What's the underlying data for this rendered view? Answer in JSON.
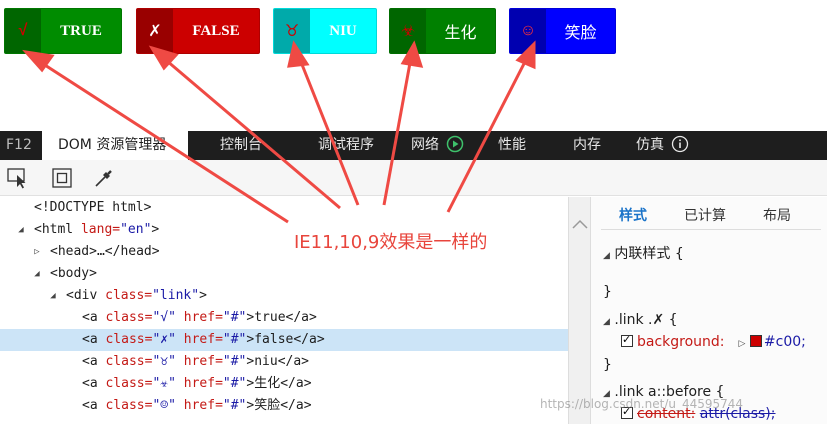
{
  "demo_buttons": [
    {
      "icon": "√",
      "label": "TRUE",
      "icon_color": "#cc0000",
      "bg": "#008c00",
      "icon_bg": "#006600"
    },
    {
      "icon": "✗",
      "label": "FALSE",
      "icon_color": "#ffffff",
      "bg": "#cc0000",
      "icon_bg": "#990000"
    },
    {
      "icon": "♉",
      "label": "NIU",
      "icon_color": "#cc0000",
      "bg": "#00ffff",
      "icon_bg": "#00aaaa"
    },
    {
      "icon": "☣",
      "label": "生化",
      "icon_color": "#cc0000",
      "bg": "#008000",
      "icon_bg": "#006600"
    },
    {
      "icon": "☺",
      "label": "笑脸",
      "icon_color": "#ff3333",
      "bg": "#0000ff",
      "icon_bg": "#0000b0"
    }
  ],
  "devtools": {
    "f12": "F12",
    "tabs": [
      "DOM 资源管理器",
      "控制台",
      "调试程序",
      "网络",
      "性能",
      "内存",
      "仿真"
    ]
  },
  "dom_tree": {
    "doctype": "<!DOCTYPE html>",
    "html_open": "<html ",
    "html_attr": "lang=",
    "html_val": "\"en\"",
    "html_close": ">",
    "head": "<head>…</head>",
    "body": "<body>",
    "div_open": "<div ",
    "div_attr": "class=",
    "div_val": "\"link\"",
    "div_close": ">",
    "links": [
      {
        "cls": "\"√\"",
        "text": "true"
      },
      {
        "cls": "\"✗\"",
        "text": "false"
      },
      {
        "cls": "\"♉\"",
        "text": "niu"
      },
      {
        "cls": "\"☣\"",
        "text": "生化"
      },
      {
        "cls": "\"☺\"",
        "text": "笑脸"
      }
    ],
    "a_open": "<a ",
    "a_class": "class=",
    "a_href": " href=",
    "a_href_val": "\"#\"",
    "a_close_tag": "</a>"
  },
  "styles_pane": {
    "tabs": [
      "样式",
      "已计算",
      "布局"
    ],
    "inline_style": "内联样式  {",
    "close_brace": "}",
    "rule1_selector": ".link .✗  {",
    "rule1_prop": "background:",
    "rule1_val": "#c00;",
    "rule2_selector": ".link a::before  {",
    "rule2_prop": "content:",
    "rule2_val": "attr(class);"
  },
  "annotation": "IE11,10,9效果是一样的",
  "watermark": "https://blog.csdn.net/u_44595744",
  "colors": {
    "annotation": "#e8453c",
    "devbar": "#1e1e1e",
    "selection": "#cce4f7"
  }
}
